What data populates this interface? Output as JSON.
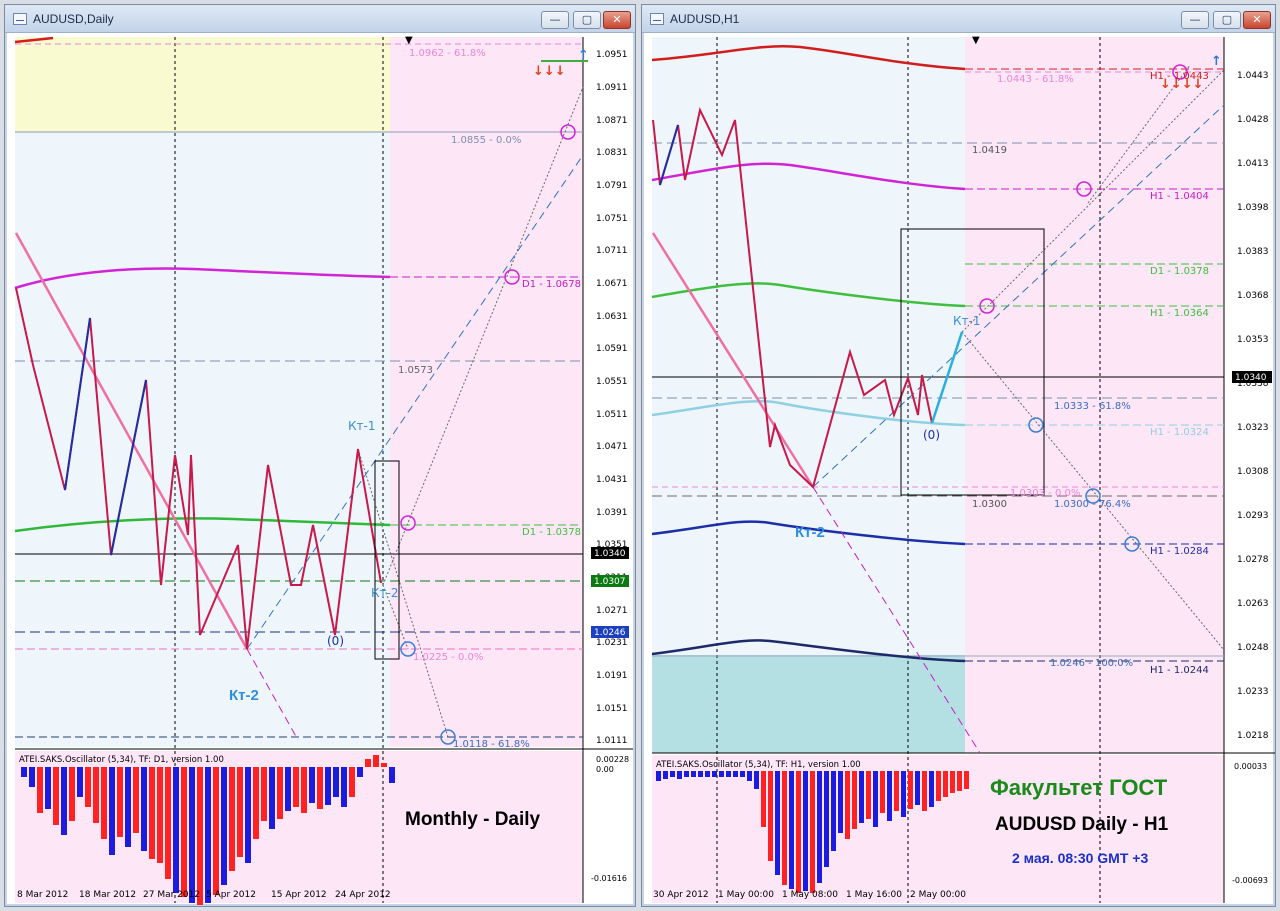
{
  "left": {
    "title": "AUDUSD,Daily",
    "buttons": {
      "min": "—",
      "max": "▢",
      "close": "✕"
    },
    "price_scale": [
      "1.0951",
      "1.0911",
      "1.0871",
      "1.0831",
      "1.0791",
      "1.0751",
      "1.0711",
      "1.0671",
      "1.0631",
      "1.0591",
      "1.0551",
      "1.0511",
      "1.0471",
      "1.0431",
      "1.0391",
      "1.0351",
      "1.0311",
      "1.0271",
      "1.0231",
      "1.0191",
      "1.0151",
      "1.0111"
    ],
    "price_current": "1.0340",
    "price_green": "1.0307",
    "price_blue": "1.0246",
    "fib_top": "1.0962 - 61.8%",
    "fib_mid": "1.0855 - 0.0%",
    "level_d1_1": "D1 - 1.0678",
    "level_1": "1.0573",
    "level_d1_2": "D1 - 1.0378",
    "fib_low": "1.0225 - 0.0%",
    "fib_bottom": "1.0118 - 61.8%",
    "kt1": "Кт-1",
    "kt2": "Кт-2",
    "kt2_big": "Кт-2",
    "zero": "(0)",
    "osc_title": "ATEI.SAKS.Oscillator (5,34), TF: D1, version 1.00",
    "osc_scale": [
      "0.00228",
      "0.00",
      "-0.01616"
    ],
    "caption": "Monthly - Daily",
    "dates": [
      "8 Mar 2012",
      "18 Mar 2012",
      "27 Mar 2012",
      "5 Apr 2012",
      "15 Apr 2012",
      "24 Apr 2012"
    ]
  },
  "right": {
    "title": "AUDUSD,H1",
    "buttons": {
      "min": "—",
      "max": "▢",
      "close": "✕"
    },
    "price_scale": [
      "1.0443",
      "1.0428",
      "1.0413",
      "1.0398",
      "1.0383",
      "1.0368",
      "1.0353",
      "1.0338",
      "1.0323",
      "1.0308",
      "1.0293",
      "1.0278",
      "1.0263",
      "1.0248",
      "1.0233",
      "1.0218"
    ],
    "price_current": "1.0340",
    "fib_top": "1.0443 - 61.8%",
    "h1_top": "H1 - 1.0443",
    "level_1": "1.0419",
    "h1_1": "H1 - 1.0404",
    "d1_1": "D1 - 1.0378",
    "h1_2": "H1 - 1.0364",
    "fib_mid": "1.0333 - 61.8%",
    "h1_3": "H1 - 1.0324",
    "fib_low1": "1.0303 - 0.0%",
    "level_2": "1.0300",
    "fib_low2": "1.0300 - 76.4%",
    "h1_4": "H1 - 1.0284",
    "fib_bottom": "1.0246 - 100.0%",
    "h1_5": "H1 - 1.0244",
    "kt1": "Кт-1",
    "kt2": "Кт-2",
    "zero": "(0)",
    "osc_title": "ATEI.SAKS.Oscillator (5,34), TF: H1, version 1.00",
    "osc_scale": [
      "0.00033",
      "-0.00693"
    ],
    "caption1": "Факультет ГОСТ",
    "caption2": "AUDUSD Daily - H1",
    "caption3": "2 мая. 08:30 GMT +3",
    "dates": [
      "30 Apr 2012",
      "1 May 00:00",
      "1 May 08:00",
      "1 May 16:00",
      "2 May 00:00"
    ]
  }
}
